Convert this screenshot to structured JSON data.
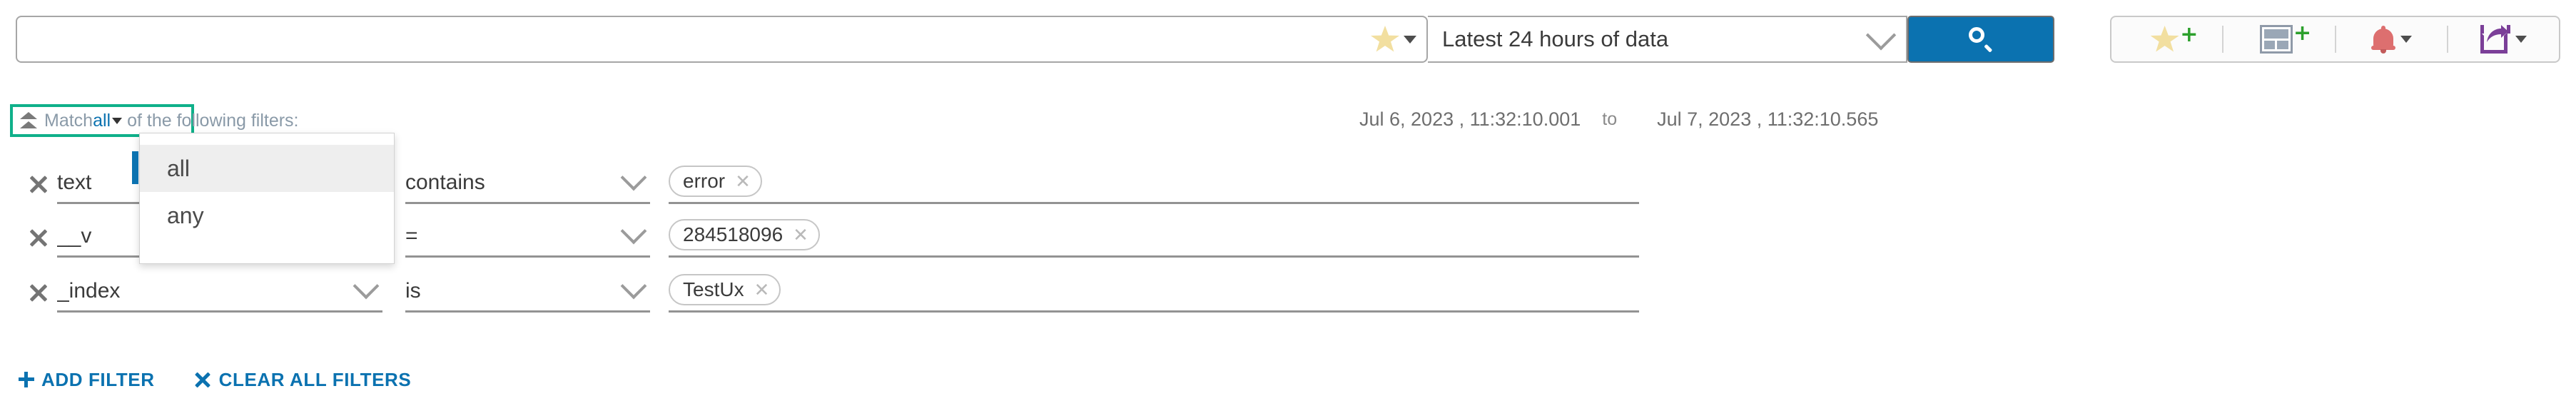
{
  "search": {
    "query": "",
    "placeholder": "",
    "star_icon": "star-icon",
    "caret_icon": "caret-down-icon"
  },
  "time_range": {
    "label": "Latest 24 hours of data",
    "chevron_icon": "chevron-down-icon"
  },
  "search_button": {
    "icon": "search-icon"
  },
  "toolbar": {
    "items": [
      {
        "name": "add-to-favorites",
        "icon": "star-plus-icon",
        "badge": "+"
      },
      {
        "name": "add-to-dashboard",
        "icon": "dashboard-plus-icon",
        "badge": "+"
      },
      {
        "name": "alerts",
        "icon": "bell-icon",
        "caret": "caret-down-icon"
      },
      {
        "name": "share-export",
        "icon": "share-icon",
        "caret": "caret-down-icon"
      }
    ]
  },
  "match_bar": {
    "collapse_icon": "double-arrow-up-icon",
    "prefix": "Match",
    "value": "all",
    "caret_icon": "caret-down-icon",
    "suffix": "of the following filters:",
    "highlight_color": "#0fb08a"
  },
  "match_dropdown": {
    "options": [
      {
        "label": "all",
        "selected": true
      },
      {
        "label": "any",
        "selected": false
      }
    ],
    "selected_marker_color": "#0b72b0"
  },
  "date_range": {
    "from": "Jul 6, 2023 ,  11:32:10.001",
    "separator": "to",
    "to": "Jul 7, 2023 ,  11:32:10.565"
  },
  "filters": [
    {
      "remove_icon": "close-icon",
      "field": "text",
      "operator": "contains",
      "values": [
        {
          "label": "error",
          "remove_icon": "close-icon"
        }
      ]
    },
    {
      "remove_icon": "close-icon",
      "field": "__v",
      "operator": "=",
      "values": [
        {
          "label": "284518096",
          "remove_icon": "close-icon"
        }
      ]
    },
    {
      "remove_icon": "close-icon",
      "field": "_index",
      "operator": "is",
      "values": [
        {
          "label": "TestUx",
          "remove_icon": "close-icon"
        }
      ]
    }
  ],
  "actions": {
    "add_filter": "ADD FILTER",
    "add_filter_icon": "plus-icon",
    "clear_all": "CLEAR ALL FILTERS",
    "clear_all_icon": "close-icon"
  },
  "colors": {
    "accent_blue": "#0b72b0",
    "highlight_green": "#0fb08a",
    "link_blue": "#0b72b0"
  }
}
